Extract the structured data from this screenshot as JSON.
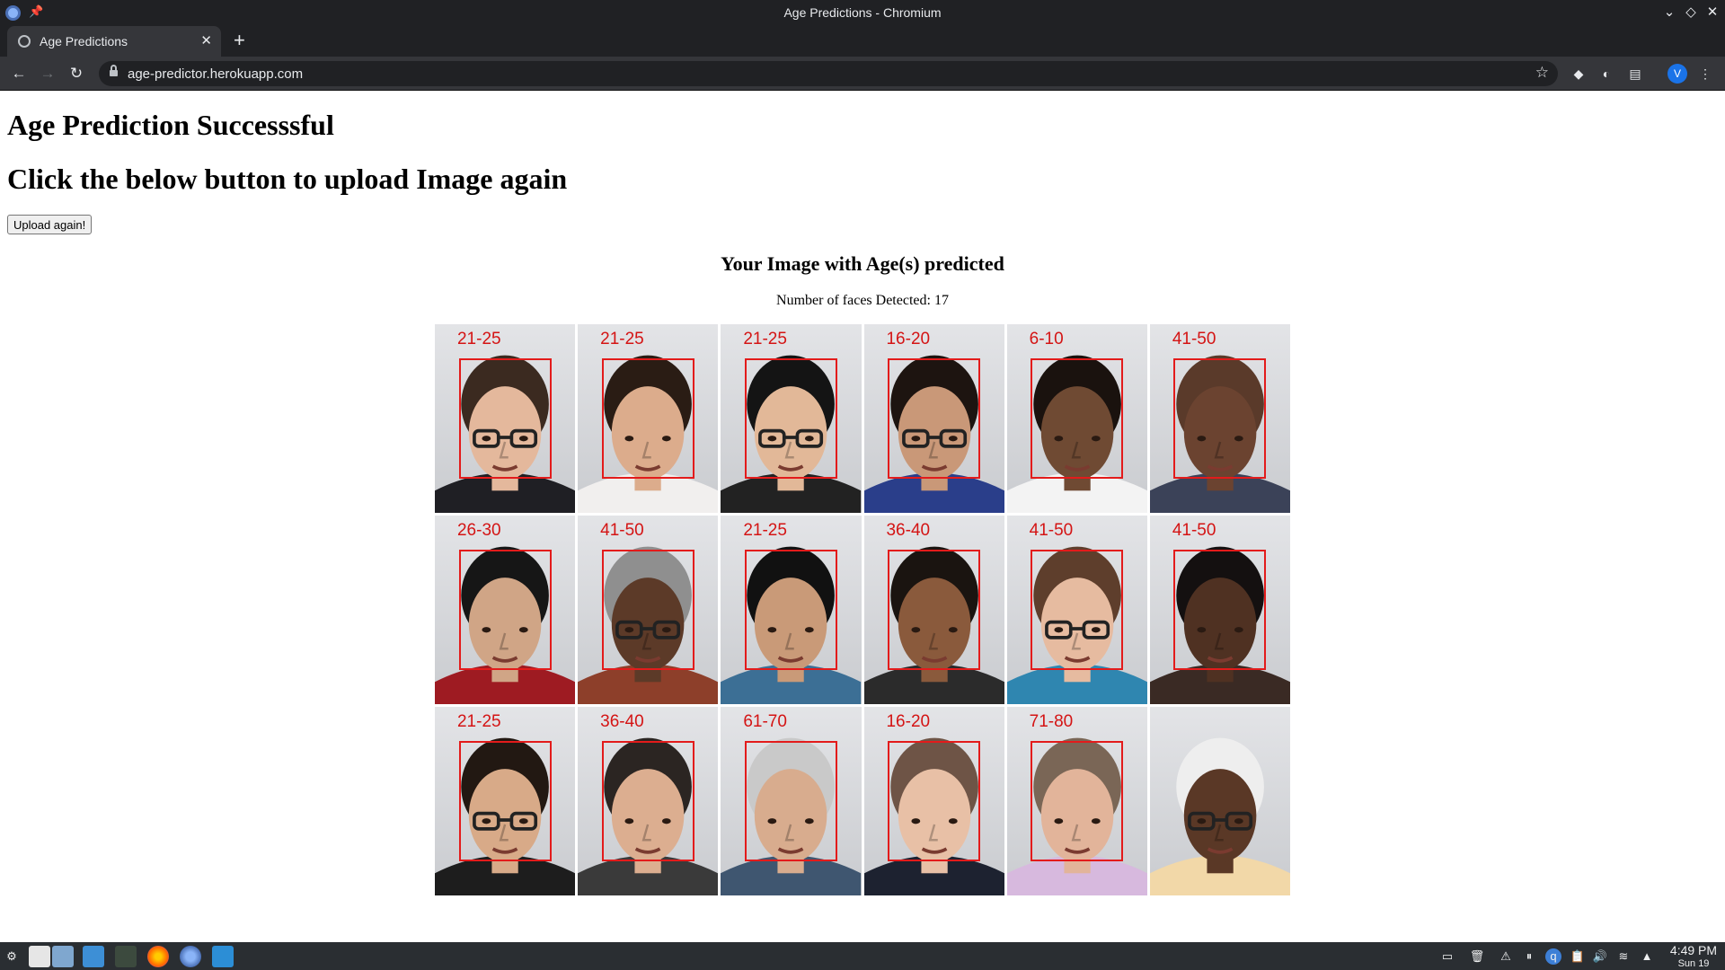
{
  "window": {
    "title": "Age Predictions - Chromium"
  },
  "tab": {
    "label": "Age Predictions"
  },
  "address_bar": {
    "url": "age-predictor.herokuapp.com"
  },
  "profile": {
    "initial": "V"
  },
  "page": {
    "heading": "Age Prediction Successsful",
    "subheading": "Click the below button to upload Image again",
    "upload_button": "Upload again!",
    "result_title": "Your Image with Age(s) predicted",
    "faces_detected": "Number of faces Detected: 17"
  },
  "faces": [
    {
      "age": "21-25",
      "skin": "#e4b89c",
      "hair": "#3b2a20",
      "shirt": "#1f1f24",
      "glasses": true
    },
    {
      "age": "21-25",
      "skin": "#dcac8c",
      "hair": "#2a1c14",
      "shirt": "#f1efee",
      "glasses": false
    },
    {
      "age": "21-25",
      "skin": "#e2b898",
      "hair": "#141414",
      "shirt": "#222222",
      "glasses": true
    },
    {
      "age": "16-20",
      "skin": "#c99878",
      "hair": "#1d1410",
      "shirt": "#2a3e8a",
      "glasses": true
    },
    {
      "age": "6-10",
      "skin": "#6f4a33",
      "hair": "#1a120e",
      "shirt": "#f3f3f3",
      "glasses": false
    },
    {
      "age": "41-50",
      "skin": "#6b4330",
      "hair": "#5a3a2a",
      "shirt": "#3b4258",
      "glasses": false
    },
    {
      "age": "26-30",
      "skin": "#d0a586",
      "hair": "#161616",
      "shirt": "#9e1b22",
      "glasses": false
    },
    {
      "age": "41-50",
      "skin": "#5c3a28",
      "hair": "#8f8f8f",
      "shirt": "#8d3f2a",
      "glasses": true
    },
    {
      "age": "21-25",
      "skin": "#c99a78",
      "hair": "#111111",
      "shirt": "#3c6f95",
      "glasses": false
    },
    {
      "age": "36-40",
      "skin": "#8a5a3c",
      "hair": "#1a1410",
      "shirt": "#2b2b2b",
      "glasses": false
    },
    {
      "age": "41-50",
      "skin": "#e6bba0",
      "hair": "#5e3e2c",
      "shirt": "#2f86b0",
      "glasses": true
    },
    {
      "age": "41-50",
      "skin": "#4f3122",
      "hair": "#141010",
      "shirt": "#3a2a24",
      "glasses": false
    },
    {
      "age": "21-25",
      "skin": "#d8aa88",
      "hair": "#221812",
      "shirt": "#1d1d1d",
      "glasses": true
    },
    {
      "age": "36-40",
      "skin": "#dcae90",
      "hair": "#2b2522",
      "shirt": "#3a3a3a",
      "glasses": false
    },
    {
      "age": "61-70",
      "skin": "#d8ac8e",
      "hair": "#c9c9c9",
      "shirt": "#3f5670",
      "glasses": false
    },
    {
      "age": "16-20",
      "skin": "#e8c0a6",
      "hair": "#6e5446",
      "shirt": "#1d2230",
      "glasses": false
    },
    {
      "age": "71-80",
      "skin": "#e2b49a",
      "hair": "#7a6656",
      "shirt": "#d7b9de",
      "glasses": false
    },
    {
      "age": "",
      "skin": "#5a3826",
      "hair": "#eeeeee",
      "shirt": "#f2d8a8",
      "glasses": true
    }
  ],
  "taskbar": {
    "time": "4:49 PM",
    "date": "Sun 19"
  }
}
